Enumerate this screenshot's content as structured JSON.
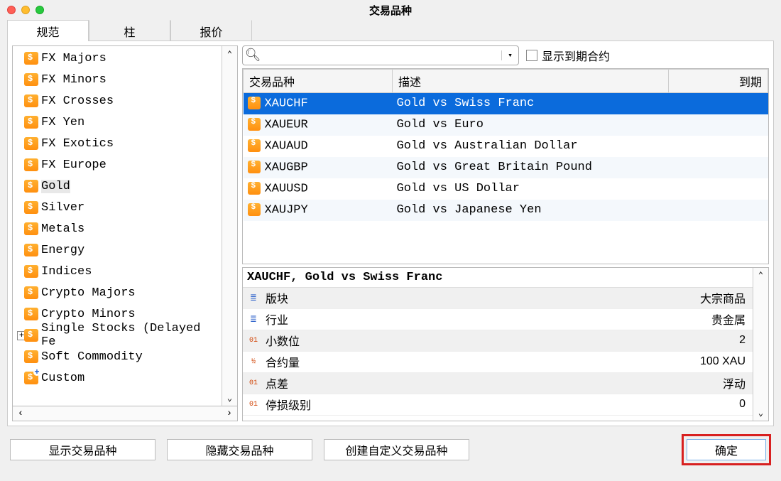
{
  "window": {
    "title": "交易品种"
  },
  "tabs": [
    "规范",
    "柱",
    "报价"
  ],
  "tree": [
    {
      "label": "FX Majors"
    },
    {
      "label": "FX Minors"
    },
    {
      "label": "FX Crosses"
    },
    {
      "label": "FX Yen"
    },
    {
      "label": "FX Exotics"
    },
    {
      "label": "FX Europe"
    },
    {
      "label": "Gold",
      "selected": true
    },
    {
      "label": "Silver"
    },
    {
      "label": "Metals"
    },
    {
      "label": "Energy"
    },
    {
      "label": "Indices"
    },
    {
      "label": "Crypto Majors"
    },
    {
      "label": "Crypto Minors"
    },
    {
      "label": "Single Stocks (Delayed Fe",
      "expandable": true
    },
    {
      "label": "Soft Commodity"
    },
    {
      "label": "Custom",
      "custom": true
    }
  ],
  "search": {
    "placeholder": ""
  },
  "show_expired": {
    "label": "显示到期合约"
  },
  "table": {
    "cols": [
      "交易品种",
      "描述",
      "到期"
    ],
    "rows": [
      {
        "sym": "XAUCHF",
        "desc": "Gold vs Swiss Franc",
        "sel": true
      },
      {
        "sym": "XAUEUR",
        "desc": "Gold vs Euro"
      },
      {
        "sym": "XAUAUD",
        "desc": "Gold vs Australian Dollar"
      },
      {
        "sym": "XAUGBP",
        "desc": "Gold vs Great Britain Pound"
      },
      {
        "sym": "XAUUSD",
        "desc": "Gold vs US Dollar"
      },
      {
        "sym": "XAUJPY",
        "desc": "Gold vs Japanese Yen"
      }
    ]
  },
  "detail": {
    "title": "XAUCHF, Gold vs Swiss Franc",
    "rows": [
      {
        "icon": "bars",
        "key": "版块",
        "val": "大宗商品",
        "shaded": true
      },
      {
        "icon": "bars",
        "key": "行业",
        "val": "贵金属"
      },
      {
        "icon": "01",
        "key": "小数位",
        "val": "2",
        "shaded": true
      },
      {
        "icon": "½",
        "key": "合约量",
        "val": "100 XAU"
      },
      {
        "icon": "01",
        "key": "点差",
        "val": "浮动",
        "shaded": true
      },
      {
        "icon": "01",
        "key": "停损级别",
        "val": "0"
      }
    ]
  },
  "footer": {
    "show": "显示交易品种",
    "hide": "隐藏交易品种",
    "create": "创建自定义交易品种",
    "ok": "确定"
  }
}
